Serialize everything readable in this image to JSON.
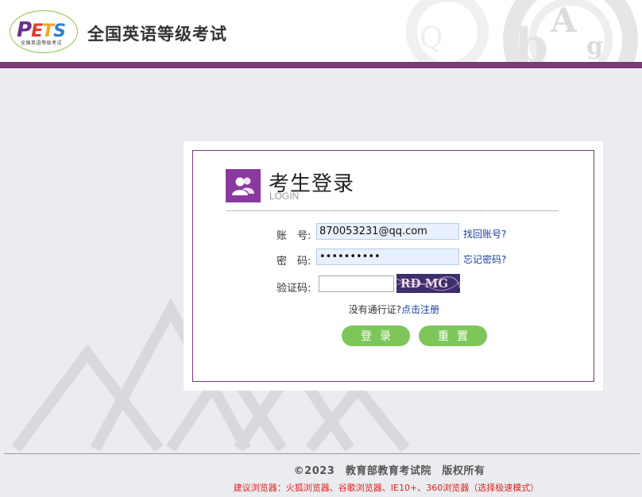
{
  "header": {
    "logo_text": "PETS",
    "logo_subtext": "全国英语等级考试",
    "title": "全国英语等级考试"
  },
  "login": {
    "title": "考生登录",
    "subtitle": "LOGIN",
    "account_label": "账　号:",
    "account_value": "870053231@qq.com",
    "find_account_link": "找回账号?",
    "password_label": "密　码:",
    "password_value": "••••••••••",
    "forgot_password_link": "忘记密码?",
    "captcha_label": "验证码:",
    "captcha_value": "",
    "captcha_text": "RD MG",
    "no_pass_text": "没有通行证?",
    "register_link": "点击注册",
    "login_button": "登录",
    "reset_button": "重置"
  },
  "footer": {
    "copyright": "©2023　教育部教育考试院　版权所有",
    "browser_tip": "建议浏览器：火狐浏览器、谷歌浏览器、IE10+、360浏览器（选择极速模式）"
  },
  "colors": {
    "brand_purple": "#7b3a73",
    "icon_purple": "#8a3a9f",
    "button_green": "#7dc75a",
    "link_blue": "#1a3fa3",
    "tip_red": "#e21f1f"
  }
}
